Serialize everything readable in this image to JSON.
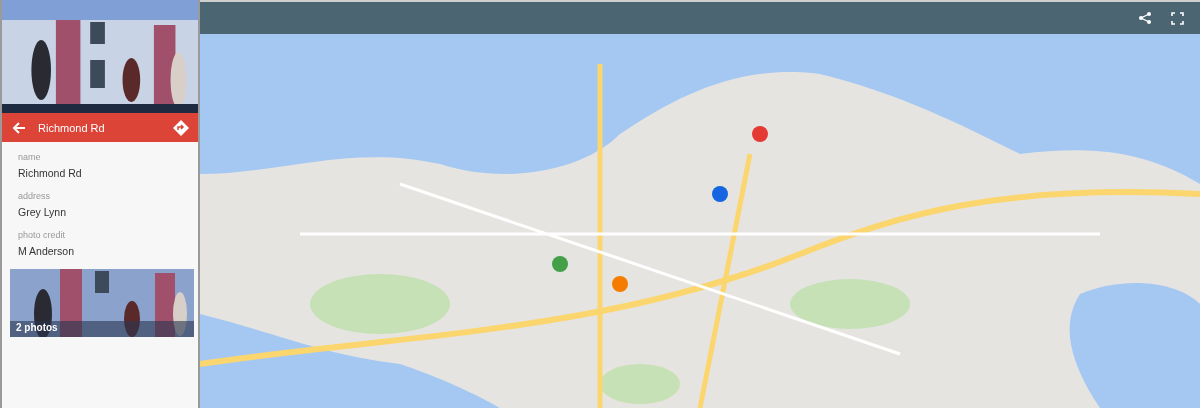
{
  "panel": {
    "title": "Richmond Rd",
    "fields": [
      {
        "label": "name",
        "value": "Richmond Rd"
      },
      {
        "label": "address",
        "value": "Grey Lynn"
      },
      {
        "label": "photo credit",
        "value": "M Anderson"
      }
    ],
    "photos_caption": "2 photos"
  }
}
